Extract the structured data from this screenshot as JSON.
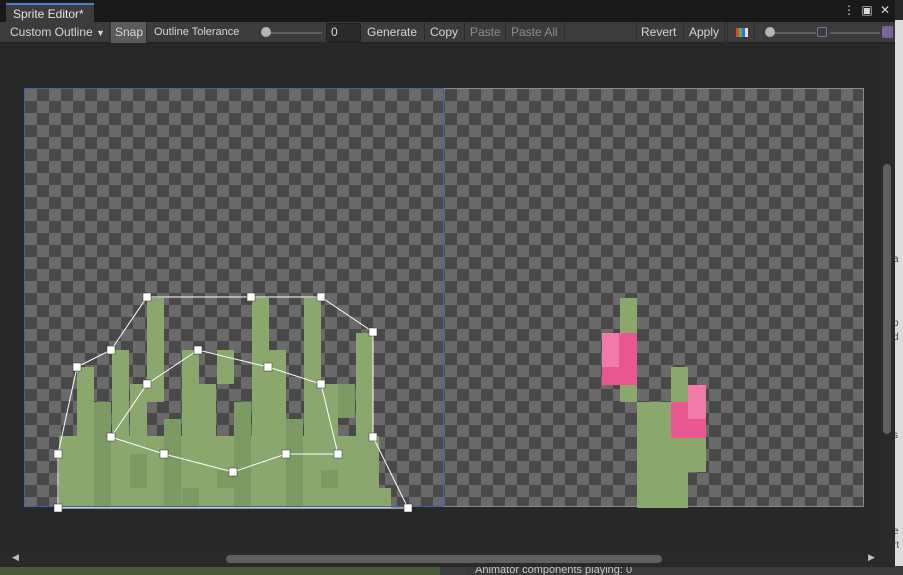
{
  "window": {
    "tab_title": "Sprite Editor*",
    "menu_icon": "kebab-menu-icon",
    "maximize_icon": "maximize-icon",
    "close_icon": "close-icon"
  },
  "toolbar": {
    "mode_label": "Custom Outline",
    "snap_label": "Snap",
    "tolerance_label": "Outline Tolerance",
    "tolerance_value": "0",
    "generate_label": "Generate",
    "copy_label": "Copy",
    "paste_label": "Paste",
    "paste_all_label": "Paste All",
    "revert_label": "Revert",
    "apply_label": "Apply"
  },
  "background": {
    "status_text": "Animator components playing: 0",
    "right_panel_chars": [
      "a",
      "p",
      "d",
      "s",
      "e",
      "rt"
    ]
  },
  "colors": {
    "grass": "#8aa86e",
    "grass_dark": "#7c9a63",
    "flower": "#e8578f",
    "flower_light": "#f07aa8",
    "outline": "#ffffff",
    "selection": "#3f63b0"
  }
}
